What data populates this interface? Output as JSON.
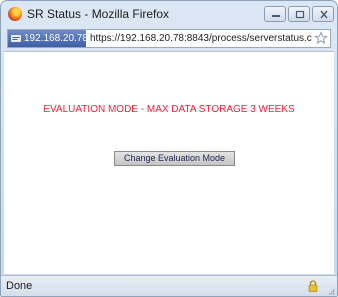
{
  "window": {
    "title": "SR Status - Mozilla Firefox"
  },
  "urlbar": {
    "identity": "192.168.20.78",
    "url": "https://192.168.20.78:8843/process/serverstatus.c"
  },
  "content": {
    "evaluation_notice": "EVALUATION MODE - MAX DATA STORAGE 3 WEEKS",
    "change_button_label": "Change Evaluation Mode"
  },
  "status": {
    "text": "Done"
  },
  "colors": {
    "notice_red": "#e8243a",
    "identity_blue": "#3f5fa5"
  },
  "icons": {
    "app": "firefox-icon",
    "minimize": "minimize-icon",
    "maximize": "maximize-icon",
    "close": "close-icon",
    "identity": "site-identity-icon",
    "bookmark": "star-icon",
    "security": "lock-icon"
  }
}
